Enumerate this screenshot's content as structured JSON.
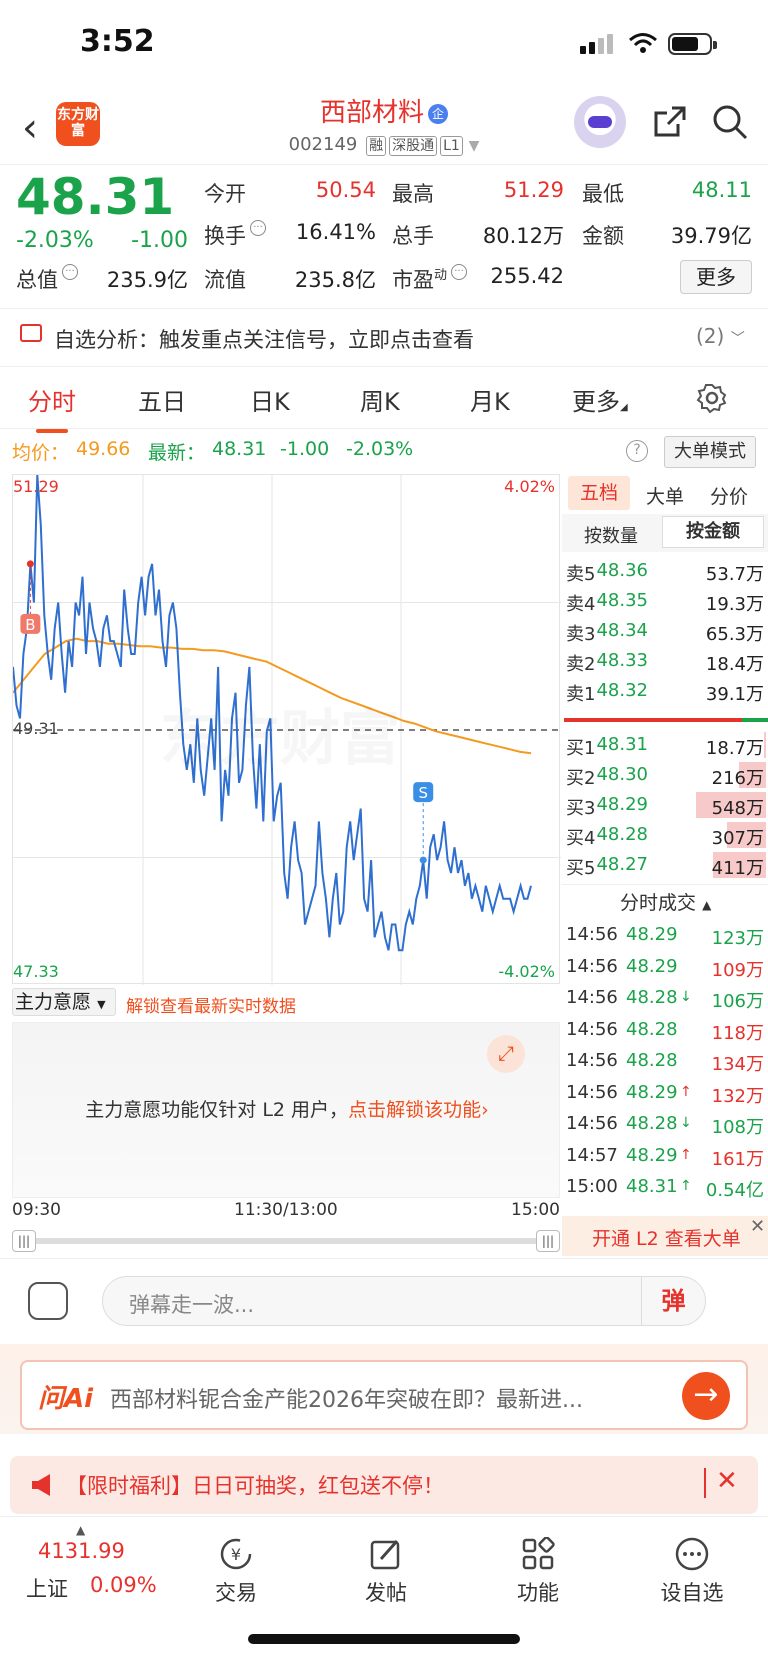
{
  "status": {
    "time": "3:52"
  },
  "header": {
    "logo_text": "东方财富",
    "title": "西部材料",
    "title_badge": "企",
    "code": "002149",
    "tags": [
      "融",
      "深股通",
      "L1"
    ]
  },
  "quote": {
    "price": "48.31",
    "change_pct": "-2.03%",
    "change": "-1.00",
    "stats": [
      {
        "label": "今开",
        "value": "50.54",
        "color": "red"
      },
      {
        "label": "最高",
        "value": "51.29",
        "color": "red"
      },
      {
        "label": "最低",
        "value": "48.11",
        "color": "green"
      },
      {
        "label": "换手",
        "value": "16.41%",
        "color": "dark"
      },
      {
        "label": "总手",
        "value": "80.12万",
        "color": "dark"
      },
      {
        "label": "金额",
        "value": "39.79亿",
        "color": "dark"
      },
      {
        "label": "总值",
        "value": "235.9亿",
        "color": "dark"
      },
      {
        "label": "流值",
        "value": "235.8亿",
        "color": "dark"
      },
      {
        "label": "市盈",
        "value": "255.42",
        "color": "dark"
      }
    ],
    "pe_sup": "动",
    "more_label": "更多"
  },
  "alert": {
    "text": "自选分析：触发重点关注信号，立即点击查看",
    "count": "(2)"
  },
  "tabs": [
    "分时",
    "五日",
    "日K",
    "周K",
    "月K",
    "更多"
  ],
  "avg_line": {
    "avg_label": "均价：",
    "avg_value": "49.66",
    "latest_label": "最新：",
    "latest_value": "48.31",
    "latest_change": "-1.00",
    "latest_pct": "-2.03%",
    "big_mode": "大单模式"
  },
  "chart_data": {
    "type": "line",
    "title": "",
    "y_max_label": "51.29",
    "y_min_label": "47.33",
    "y_mid_label": "49.31",
    "pct_max_label": "4.02%",
    "pct_min_label": "-4.02%",
    "ylim": [
      47.33,
      51.29
    ],
    "prev_close": 49.31,
    "x_labels": [
      "09:30",
      "11:30/13:00",
      "15:00"
    ],
    "series": [
      {
        "values": [
          49.8,
          49.5,
          49.4,
          49.9,
          50.1,
          50.6,
          50.3,
          51.29,
          50.9,
          50.2,
          49.9,
          49.7,
          50.1,
          50.3,
          49.9,
          49.6,
          50.0,
          49.8,
          50.3,
          50.2,
          50.5,
          49.9,
          50.3,
          50.1,
          50.0,
          49.8,
          50.1,
          50.2,
          50.0,
          50.0,
          49.9,
          49.8,
          50.4,
          50.1,
          49.9,
          49.9,
          50.3,
          50.5,
          50.2,
          50.5,
          50.6,
          50.2,
          50.4,
          50.0,
          49.8,
          50.2,
          50.3,
          50.1,
          49.6,
          49.2,
          49.0,
          49.2,
          48.9,
          49.4,
          49.0,
          48.8,
          49.1,
          49.4,
          49.0,
          49.8,
          48.6,
          49.0,
          48.8,
          49.4,
          49.6,
          48.9,
          49.0,
          49.5,
          49.8,
          49.1,
          48.7,
          49.2,
          48.6,
          49.3,
          49.4,
          48.6,
          48.8,
          48.9,
          48.2,
          48.0,
          48.4,
          48.6,
          48.3,
          48.2,
          47.8,
          47.9,
          48.0,
          48.1,
          48.6,
          48.2,
          48.0,
          47.7,
          48.0,
          48.2,
          47.8,
          47.9,
          48.4,
          48.6,
          48.3,
          48.5,
          48.7,
          48.0,
          47.9,
          48.3,
          47.7,
          47.8,
          47.9,
          47.7,
          47.6,
          47.8,
          47.8,
          47.6,
          47.6,
          47.8,
          47.9,
          47.8,
          48.0,
          48.1,
          48.3,
          48.0,
          48.4,
          48.5,
          48.3,
          48.4,
          48.6,
          48.3,
          48.2,
          48.4,
          48.2,
          48.3,
          48.1,
          48.2,
          48.0,
          48.1,
          48.0,
          47.9,
          48.1,
          48.0,
          47.9,
          48.0,
          48.1,
          48.0,
          48.0,
          48.0,
          47.9,
          48.0,
          48.1,
          48.0,
          48.0,
          48.1
        ]
      },
      {
        "values": [
          49.6,
          49.7,
          49.8,
          49.9,
          49.95,
          50.0,
          50.02,
          50.0,
          50.0,
          49.98,
          49.98,
          49.97,
          49.96,
          49.96,
          49.95,
          49.95,
          49.94,
          49.94,
          49.93,
          49.93,
          49.92,
          49.9,
          49.88,
          49.86,
          49.84,
          49.8,
          49.76,
          49.72,
          49.68,
          49.64,
          49.6,
          49.56,
          49.53,
          49.5,
          49.47,
          49.44,
          49.41,
          49.38,
          49.36,
          49.33,
          49.3,
          49.28,
          49.26,
          49.24,
          49.22,
          49.2,
          49.18,
          49.16,
          49.14,
          49.13
        ]
      }
    ],
    "markers": [
      {
        "label": "B"
      },
      {
        "label": "S"
      }
    ]
  },
  "orderbook": {
    "tabs": [
      "五档",
      "大单",
      "分价"
    ],
    "subtabs": [
      "按数量",
      "按金额"
    ],
    "asks": [
      {
        "label": "卖5",
        "price": "48.36",
        "amount": "53.7万",
        "ratio": 0.1
      },
      {
        "label": "卖4",
        "price": "48.35",
        "amount": "19.3万",
        "ratio": 0.04
      },
      {
        "label": "卖3",
        "price": "48.34",
        "amount": "65.3万",
        "ratio": 0.12
      },
      {
        "label": "卖2",
        "price": "48.33",
        "amount": "18.4万",
        "ratio": 0.03
      },
      {
        "label": "卖1",
        "price": "48.32",
        "amount": "39.1万",
        "ratio": 0.07
      }
    ],
    "bids": [
      {
        "label": "买1",
        "price": "48.31",
        "amount": "18.7万",
        "ratio": 0.03
      },
      {
        "label": "买2",
        "price": "48.30",
        "amount": "216万",
        "ratio": 0.39
      },
      {
        "label": "买3",
        "price": "48.29",
        "amount": "548万",
        "ratio": 1.0
      },
      {
        "label": "买4",
        "price": "48.28",
        "amount": "307万",
        "ratio": 0.56
      },
      {
        "label": "买5",
        "price": "48.27",
        "amount": "411万",
        "ratio": 0.75
      }
    ],
    "trades_title": "分时成交",
    "trades": [
      {
        "time": "14:56",
        "price": "48.29",
        "arrow": "",
        "vol": "123万",
        "color": "green"
      },
      {
        "time": "14:56",
        "price": "48.29",
        "arrow": "",
        "vol": "109万",
        "color": "red"
      },
      {
        "time": "14:56",
        "price": "48.28",
        "arrow": "↓",
        "vol": "106万",
        "color": "green"
      },
      {
        "time": "14:56",
        "price": "48.28",
        "arrow": "",
        "vol": "118万",
        "color": "red"
      },
      {
        "time": "14:56",
        "price": "48.28",
        "arrow": "",
        "vol": "134万",
        "color": "red"
      },
      {
        "time": "14:56",
        "price": "48.29",
        "arrow": "↑",
        "vol": "132万",
        "color": "red"
      },
      {
        "time": "14:56",
        "price": "48.28",
        "arrow": "↓",
        "vol": "108万",
        "color": "green"
      },
      {
        "time": "14:57",
        "price": "48.29",
        "arrow": "↑",
        "vol": "161万",
        "color": "red"
      },
      {
        "time": "15:00",
        "price": "48.31",
        "arrow": "↑",
        "vol": "0.54亿",
        "color": "green"
      }
    ],
    "l2_label": "开通 L2 查看大单"
  },
  "mainforce": {
    "select": "主力意愿",
    "unlock_link": "解锁查看最新实时数据",
    "body_text": "主力意愿功能仅针对 L2 用户，",
    "body_link": "点击解锁该功能"
  },
  "danmu": {
    "placeholder": "弹幕走一波...",
    "btn": "弹"
  },
  "ai": {
    "logo": "问Ai",
    "text": "西部材料铌合金产能2026年突破在即？最新进..."
  },
  "promo": {
    "text": "【限时福利】日日可抽奖，红包送不停！"
  },
  "bottom_nav": {
    "index_value": "4131.99",
    "index_name": "上证",
    "index_pct": "0.09%",
    "items": [
      "交易",
      "发帖",
      "功能",
      "设自选"
    ]
  },
  "colors": {
    "red": "#e6322d",
    "green": "#1aa34a",
    "orange": "#f0501e",
    "avg": "#f39a1f",
    "price_line": "#2f6fd0"
  }
}
